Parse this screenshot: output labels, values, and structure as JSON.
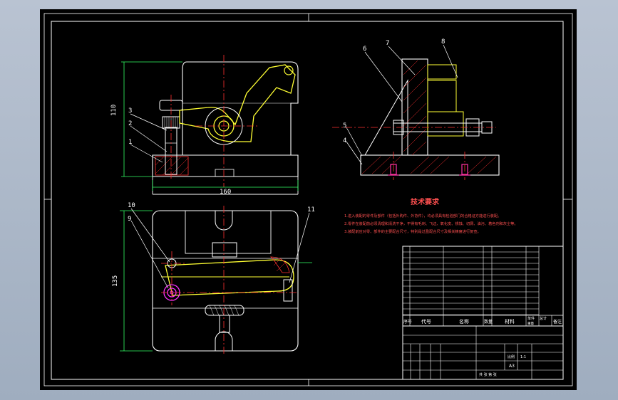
{
  "colors": {
    "background": "#000000",
    "outline": "#ffffff",
    "center_line": "#ff3030",
    "dimension": "#33ff66",
    "part_yellow": "#ffff33",
    "text_red": "#ff5050",
    "hatch_red": "#ff3030",
    "bolt_pink": "#ff33aa",
    "highlight_magenta": "#ff33ff"
  },
  "front_view": {
    "dim_height": "110",
    "dim_width": "160",
    "labels": [
      "3",
      "2",
      "1"
    ]
  },
  "side_view": {
    "labels": [
      "6",
      "7",
      "8",
      "5",
      "4"
    ]
  },
  "top_view": {
    "dim_height": "135",
    "labels": [
      "10",
      "9",
      "11"
    ]
  },
  "tech_requirements": {
    "title": "技术要求",
    "lines": [
      "1.进入装配的零件及部件（包括外购件、外协件），均必须具有检验部门的合格证方能进行装配。",
      "2.零件在装配前必须清理和清洗干净，不得有毛刺、飞边、氧化皮、锈蚀、切屑、油污、着色剂和灰尘等。",
      "3.装配前应对零、部件的主要配合尺寸，特别是过盈配合尺寸及相关精度进行复查。"
    ]
  },
  "title_block": {
    "header": [
      "序号",
      "代号",
      "名称",
      "数量",
      "材料",
      "单件",
      "总计",
      "备注"
    ],
    "mass_header": "重量",
    "scale_label": "比例",
    "scale_value": "1:1",
    "sheet_label": "共 张 第 张",
    "code": "A3"
  }
}
